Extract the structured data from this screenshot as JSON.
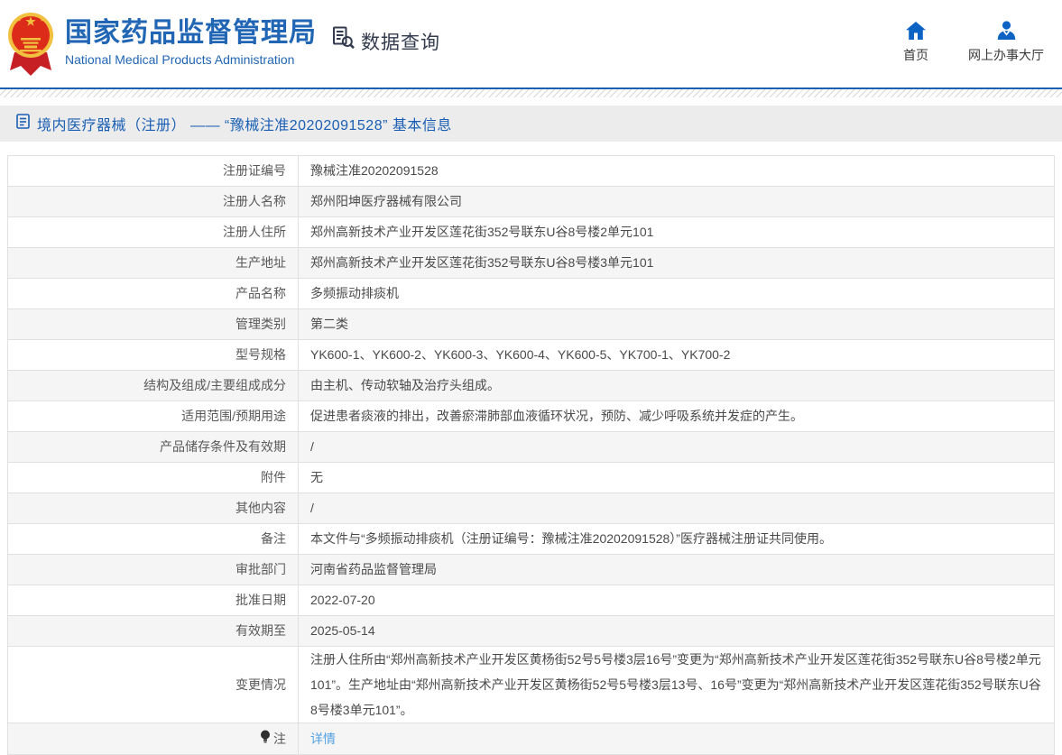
{
  "header": {
    "org_cn": "国家药品监督管理局",
    "org_en": "National Medical Products Administration",
    "data_query_label": "数据查询",
    "nav": [
      {
        "label": "首页",
        "icon": "home-icon"
      },
      {
        "label": "网上办事大厅",
        "icon": "user-icon"
      }
    ]
  },
  "page": {
    "title": "境内医疗器械（注册） —— “豫械注准20202091528” 基本信息"
  },
  "table": {
    "rows": [
      {
        "label": "注册证编号",
        "value": "豫械注准20202091528"
      },
      {
        "label": "注册人名称",
        "value": "郑州阳坤医疗器械有限公司"
      },
      {
        "label": "注册人住所",
        "value": "郑州高新技术产业开发区莲花街352号联东U谷8号楼2单元101"
      },
      {
        "label": "生产地址",
        "value": "郑州高新技术产业开发区莲花街352号联东U谷8号楼3单元101"
      },
      {
        "label": "产品名称",
        "value": "多频振动排痰机"
      },
      {
        "label": "管理类别",
        "value": "第二类"
      },
      {
        "label": "型号规格",
        "value": "YK600-1、YK600-2、YK600-3、YK600-4、YK600-5、YK700-1、YK700-2"
      },
      {
        "label": "结构及组成/主要组成成分",
        "value": "由主机、传动软轴及治疗头组成。"
      },
      {
        "label": "适用范围/预期用途",
        "value": "促进患者痰液的排出，改善瘀滞肺部血液循环状况，预防、减少呼吸系统并发症的产生。"
      },
      {
        "label": "产品储存条件及有效期",
        "value": "/"
      },
      {
        "label": "附件",
        "value": "无"
      },
      {
        "label": "其他内容",
        "value": "/"
      },
      {
        "label": "备注",
        "value": "本文件与“多频振动排痰机（注册证编号：豫械注准20202091528）”医疗器械注册证共同使用。"
      },
      {
        "label": "审批部门",
        "value": "河南省药品监督管理局"
      },
      {
        "label": "批准日期",
        "value": "2022-07-20"
      },
      {
        "label": "有效期至",
        "value": "2025-05-14"
      },
      {
        "label": "变更情况",
        "value": "注册人住所由“郑州高新技术产业开发区黄杨街52号5号楼3层16号”变更为“郑州高新技术产业开发区莲花街352号联东U谷8号楼2单元101”。生产地址由“郑州高新技术产业开发区黄杨街52号5号楼3层13号、16号”变更为“郑州高新技术产业开发区莲花街352号联东U谷8号楼3单元101”。"
      },
      {
        "label": "注",
        "value": "详情"
      }
    ]
  },
  "colors": {
    "brand_blue": "#2166b4",
    "divider_blue": "#1d61ae",
    "icon_blue": "#0d63c4",
    "link_blue": "#54a1e1",
    "title_bar_bg": "#ececec",
    "zebra_row_bg": "#f5f5f5",
    "emblem_red": "#dc2b19",
    "emblem_gold": "#f0c03e"
  }
}
